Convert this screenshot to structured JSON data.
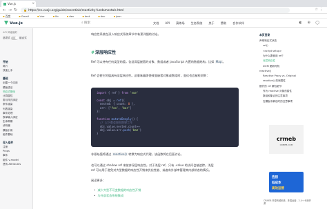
{
  "browser": {
    "tab_title": "Vue.js",
    "url": "https://cn.vuejs.org/guide/essentials/reactivity-fundamentals.html",
    "bookmarks": [
      "百度",
      "Gmail",
      "Vue",
      "lib",
      "dev",
      "test",
      "doc",
      "json"
    ]
  },
  "header": {
    "logo": "Vue.js",
    "search_label": "搜索",
    "nav": [
      "文档",
      "API",
      "演练场",
      "生态系统",
      "关于",
      "赞助",
      "合作伙伴"
    ]
  },
  "sidebar": {
    "api_pref_label": "API 风格偏好",
    "pref_options": [
      "选项式",
      "组合式"
    ],
    "groups": [
      {
        "label": "开始",
        "items": [
          "简介",
          "快速上手"
        ]
      },
      {
        "label": "基础",
        "items": [
          "创建一个应用",
          "模板语法",
          "响应式基础",
          "计算属性",
          "类与样式绑定",
          "条件渲染",
          "列表渲染",
          "事件处理",
          "表单输入绑定",
          "生命周期",
          "侦听器",
          "模板引用",
          "组件基础"
        ]
      },
      {
        "label": "深入组件",
        "items": [
          "注册",
          "Props",
          "事件",
          "组件 v-model",
          "透传 Attributes"
        ]
      }
    ],
    "active_item": "响应式基础"
  },
  "content": {
    "intro_line": "响应性系统在深入响应式系统章节中有更详细的讨论。",
    "section_title": "深层响应性",
    "para1": "Ref 可以持有任何类型的值，包括深层嵌套的对象、数组或者 JavaScript 内置的数据结构，比如",
    "para1_code": "Map",
    "para2": "Ref 会使它的值具有深层响应性。这意味着即使改变嵌套对象或数组时，变化也会被检测到：",
    "code_lines": [
      {
        "parts": [
          [
            "k",
            "import"
          ],
          [
            "p",
            " { ref } "
          ],
          [
            "k",
            "from"
          ],
          [
            "s",
            " 'vue'"
          ]
        ]
      },
      {
        "parts": [
          [
            "p",
            " "
          ]
        ]
      },
      {
        "parts": [
          [
            "k",
            "const"
          ],
          [
            "p",
            " obj = "
          ],
          [
            "f",
            "ref"
          ],
          [
            "p",
            "({"
          ]
        ]
      },
      {
        "parts": [
          [
            "p",
            "  nested: { count: "
          ],
          [
            "n",
            "0"
          ],
          [
            "p",
            " },"
          ]
        ]
      },
      {
        "parts": [
          [
            "p",
            "  arr: ["
          ],
          [
            "s",
            "'foo'"
          ],
          [
            "p",
            ", "
          ],
          [
            "s",
            "'bar'"
          ],
          [
            "p",
            "]"
          ]
        ]
      },
      {
        "parts": [
          [
            "p",
            "})"
          ]
        ]
      },
      {
        "parts": [
          [
            "p",
            " "
          ]
        ]
      },
      {
        "parts": [
          [
            "k",
            "function"
          ],
          [
            "f",
            " mutateDeeply"
          ],
          [
            "p",
            "() {"
          ]
        ]
      },
      {
        "parts": [
          [
            "c",
            "  // 以下都会按照期望工作"
          ]
        ]
      },
      {
        "parts": [
          [
            "p",
            "  obj.value.nested.count++"
          ]
        ]
      },
      {
        "parts": [
          [
            "p",
            "  obj.value.arr."
          ],
          [
            "f",
            "push"
          ],
          [
            "p",
            "("
          ],
          [
            "s",
            "'baz'"
          ],
          [
            "p",
            ")"
          ]
        ]
      },
      {
        "parts": [
          [
            "p",
            "}"
          ]
        ]
      }
    ],
    "para3_a": "非原始值将通过",
    "para3_code": "reactive()",
    "para3_b": "转换为响应式代理，该函数将在后面讨论。",
    "para4": "也可以通过 shallow ref 来放弃深层响应性。对于浅层 ref，只有 .value 的访问会被追踪。浅层",
    "para5": "ref 可以用于避免对大型数据的响应性开销来优化性能、或者有外部库管理其内部状态的情况。",
    "read_more": "阅读更多：",
    "links": [
      "减少大型不可变数据的响应性开销",
      "与外部状态系统集成"
    ]
  },
  "outline": {
    "title": "本页目录",
    "items": [
      {
        "label": "声明响应式状态",
        "indent": 0
      },
      {
        "label": "ref()",
        "indent": 1
      },
      {
        "label": "<script setup>",
        "indent": 1
      },
      {
        "label": "为什么要使用 ref？",
        "indent": 1
      },
      {
        "label": "深层响应性",
        "indent": 1,
        "active": true
      },
      {
        "label": "DOM 更新时机",
        "indent": 1
      },
      {
        "label": "reactive()",
        "indent": 0
      },
      {
        "label": "Reactive Proxy vs. Original",
        "indent": 1
      },
      {
        "label": "reactive() 的局限性",
        "indent": 1
      },
      {
        "label": "额外的 ref 解包细节",
        "indent": 0
      },
      {
        "label": "作为 reactive 对象的属性",
        "indent": 1
      },
      {
        "label": "数组和集合的注意事项",
        "indent": 1
      },
      {
        "label": "在模板中解包时的注意事项",
        "indent": 1
      }
    ]
  },
  "ad": {
    "brand": "crmeb",
    "brand_sub": "CRMEB.COM",
    "line1": "告别",
    "line2": "低成本",
    "line3": "高效运营",
    "caption": "CRMEB 开源商城系统，多端运营，2.4+ 代码开源"
  }
}
